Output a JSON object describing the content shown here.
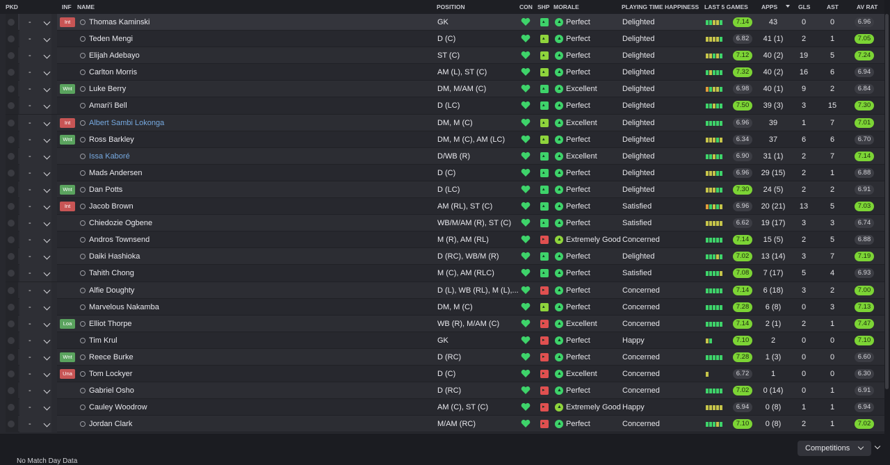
{
  "header": {
    "pkd": "PKD",
    "inf": "INF",
    "name": "NAME",
    "position": "POSITION",
    "con": "CON",
    "shp": "SHP",
    "morale": "MORALE",
    "playing_time": "PLAYING TIME HAPPINESS",
    "last5": "LAST 5 GAMES",
    "apps": "APPS",
    "gls": "GLS",
    "ast": "AST",
    "avrat": "AV RAT"
  },
  "colors": {
    "green": "#3ed36a",
    "light_green": "#8fd43c",
    "red": "#e05050",
    "rating_highlight": "#7cd435",
    "injury_tag": "#c85555",
    "want_tag": "#5aa35e"
  },
  "players": [
    {
      "inf": "Int",
      "name": "Thomas Kaminski",
      "link": false,
      "pos": "GK",
      "shp": "g",
      "morale": "Perfect",
      "mor": "g",
      "pt": "Delighted",
      "form": [
        "fg",
        "fg",
        "fy",
        "fy",
        "fg"
      ],
      "last": "7.14",
      "last_hi": true,
      "apps": "43",
      "gls": "0",
      "ast": "0",
      "av": "6.96",
      "av_hi": false
    },
    {
      "inf": "",
      "name": "Teden Mengi",
      "link": false,
      "pos": "D (C)",
      "shp": "y",
      "morale": "Perfect",
      "mor": "g",
      "pt": "Delighted",
      "form": [
        "fy",
        "fy",
        "fy",
        "fy",
        "fg"
      ],
      "last": "6.82",
      "last_hi": false,
      "apps": "41 (1)",
      "gls": "2",
      "ast": "1",
      "av": "7.05",
      "av_hi": true
    },
    {
      "inf": "",
      "name": "Elijah Adebayo",
      "link": false,
      "pos": "ST (C)",
      "shp": "y",
      "morale": "Perfect",
      "mor": "g",
      "pt": "Delighted",
      "form": [
        "fy",
        "fy",
        "fg",
        "fy",
        "fg"
      ],
      "last": "7.12",
      "last_hi": true,
      "apps": "40 (2)",
      "gls": "19",
      "ast": "5",
      "av": "7.24",
      "av_hi": true
    },
    {
      "inf": "",
      "name": "Carlton Morris",
      "link": false,
      "pos": "AM (L), ST (C)",
      "shp": "y",
      "morale": "Perfect",
      "mor": "g",
      "pt": "Delighted",
      "form": [
        "fg",
        "fy",
        "fg",
        "fg",
        "fg"
      ],
      "last": "7.32",
      "last_hi": true,
      "apps": "40 (2)",
      "gls": "16",
      "ast": "6",
      "av": "6.94",
      "av_hi": false
    },
    {
      "inf": "Wnt",
      "name": "Luke Berry",
      "link": false,
      "pos": "DM, M/AM (C)",
      "shp": "g",
      "morale": "Excellent",
      "mor": "g",
      "pt": "Delighted",
      "form": [
        "fo",
        "fg",
        "fy",
        "fy",
        "fg"
      ],
      "last": "6.98",
      "last_hi": false,
      "apps": "40 (1)",
      "gls": "9",
      "ast": "2",
      "av": "6.84",
      "av_hi": false
    },
    {
      "inf": "",
      "name": "Amari'i Bell",
      "link": false,
      "pos": "D (LC)",
      "shp": "g",
      "morale": "Perfect",
      "mor": "g",
      "pt": "Delighted",
      "form": [
        "fg",
        "fg",
        "fy",
        "fg",
        "fg"
      ],
      "last": "7.50",
      "last_hi": true,
      "apps": "39 (3)",
      "gls": "3",
      "ast": "15",
      "av": "7.30",
      "av_hi": true
    },
    {
      "inf": "Int",
      "name": "Albert Sambi Lokonga",
      "link": true,
      "pos": "DM, M (C)",
      "shp": "y",
      "morale": "Excellent",
      "mor": "g",
      "pt": "Delighted",
      "form": [
        "fg",
        "fg",
        "fg",
        "fg",
        "fg"
      ],
      "last": "6.96",
      "last_hi": false,
      "apps": "39",
      "gls": "1",
      "ast": "7",
      "av": "7.01",
      "av_hi": true
    },
    {
      "inf": "Wnt",
      "name": "Ross Barkley",
      "link": false,
      "pos": "DM, M (C), AM (LC)",
      "shp": "y",
      "morale": "Perfect",
      "mor": "g",
      "pt": "Delighted",
      "form": [
        "fy",
        "fy",
        "fy",
        "fg",
        "fy"
      ],
      "last": "6.34",
      "last_hi": false,
      "apps": "37",
      "gls": "6",
      "ast": "6",
      "av": "6.70",
      "av_hi": false
    },
    {
      "inf": "",
      "name": "Issa Kaboré",
      "link": true,
      "pos": "D/WB (R)",
      "shp": "g",
      "morale": "Excellent",
      "mor": "g",
      "pt": "Delighted",
      "form": [
        "fg",
        "fg",
        "fy",
        "fg",
        "fg"
      ],
      "last": "6.90",
      "last_hi": false,
      "apps": "31 (1)",
      "gls": "2",
      "ast": "7",
      "av": "7.14",
      "av_hi": true
    },
    {
      "inf": "",
      "name": "Mads Andersen",
      "link": false,
      "pos": "D (C)",
      "shp": "g",
      "morale": "Perfect",
      "mor": "g",
      "pt": "Delighted",
      "form": [
        "fy",
        "fy",
        "fy",
        "fg",
        "fg"
      ],
      "last": "6.96",
      "last_hi": false,
      "apps": "29 (15)",
      "gls": "2",
      "ast": "1",
      "av": "6.88",
      "av_hi": false
    },
    {
      "inf": "Wnt",
      "name": "Dan Potts",
      "link": false,
      "pos": "D (LC)",
      "shp": "g",
      "morale": "Perfect",
      "mor": "g",
      "pt": "Delighted",
      "form": [
        "fy",
        "fy",
        "fy",
        "fg",
        "fg"
      ],
      "last": "7.30",
      "last_hi": true,
      "apps": "24 (5)",
      "gls": "2",
      "ast": "2",
      "av": "6.91",
      "av_hi": false
    },
    {
      "inf": "Int",
      "name": "Jacob Brown",
      "link": false,
      "pos": "AM (RL), ST (C)",
      "shp": "g",
      "morale": "Perfect",
      "mor": "g",
      "pt": "Satisfied",
      "form": [
        "fo",
        "fg",
        "fy",
        "fg",
        "fy"
      ],
      "last": "6.96",
      "last_hi": false,
      "apps": "20 (21)",
      "gls": "13",
      "ast": "5",
      "av": "7.03",
      "av_hi": true
    },
    {
      "inf": "",
      "name": "Chiedozie Ogbene",
      "link": false,
      "pos": "WB/M/AM (R), ST (C)",
      "shp": "g",
      "morale": "Perfect",
      "mor": "g",
      "pt": "Satisfied",
      "form": [
        "fy",
        "fy",
        "fy",
        "fy",
        "fy"
      ],
      "last": "6.62",
      "last_hi": false,
      "apps": "19 (17)",
      "gls": "3",
      "ast": "3",
      "av": "6.74",
      "av_hi": false
    },
    {
      "inf": "",
      "name": "Andros Townsend",
      "link": false,
      "pos": "M (R), AM (RL)",
      "shp": "r",
      "morale": "Extremely Good",
      "mor": "lg",
      "pt": "Concerned",
      "form": [
        "fg",
        "fg",
        "fg",
        "fg",
        "fg"
      ],
      "last": "7.14",
      "last_hi": true,
      "apps": "15 (5)",
      "gls": "2",
      "ast": "5",
      "av": "6.88",
      "av_hi": false
    },
    {
      "inf": "",
      "name": "Daiki Hashioka",
      "link": false,
      "pos": "D (RC), WB/M (R)",
      "shp": "g",
      "morale": "Perfect",
      "mor": "g",
      "pt": "Delighted",
      "form": [
        "fg",
        "fg",
        "fg",
        "fy",
        "fg"
      ],
      "last": "7.02",
      "last_hi": true,
      "apps": "13 (14)",
      "gls": "3",
      "ast": "7",
      "av": "7.19",
      "av_hi": true
    },
    {
      "inf": "",
      "name": "Tahith Chong",
      "link": false,
      "pos": "M (C), AM (RLC)",
      "shp": "g",
      "morale": "Perfect",
      "mor": "g",
      "pt": "Satisfied",
      "form": [
        "fg",
        "fg",
        "fg",
        "fg",
        "fy"
      ],
      "last": "7.08",
      "last_hi": true,
      "apps": "7 (17)",
      "gls": "5",
      "ast": "4",
      "av": "6.93",
      "av_hi": false
    },
    {
      "inf": "",
      "name": "Alfie Doughty",
      "link": false,
      "pos": "D (L), WB (RL), M (L),...",
      "shp": "r",
      "morale": "Perfect",
      "mor": "g",
      "pt": "Concerned",
      "form": [
        "fg",
        "fg",
        "fg",
        "fg",
        "fg"
      ],
      "last": "7.14",
      "last_hi": true,
      "apps": "6 (18)",
      "gls": "3",
      "ast": "2",
      "av": "7.00",
      "av_hi": true
    },
    {
      "inf": "",
      "name": "Marvelous Nakamba",
      "link": false,
      "pos": "DM, M (C)",
      "shp": "y",
      "morale": "Perfect",
      "mor": "g",
      "pt": "Concerned",
      "form": [
        "fg",
        "fg",
        "fg",
        "fg",
        "fg"
      ],
      "last": "7.28",
      "last_hi": true,
      "apps": "6 (8)",
      "gls": "0",
      "ast": "3",
      "av": "7.13",
      "av_hi": true
    },
    {
      "inf": "Loa",
      "name": "Elliot Thorpe",
      "link": false,
      "pos": "WB (R), M/AM (C)",
      "shp": "r",
      "morale": "Excellent",
      "mor": "g",
      "pt": "Concerned",
      "form": [
        "fg",
        "fg",
        "fg",
        "fg",
        "fg"
      ],
      "last": "7.14",
      "last_hi": true,
      "apps": "2 (1)",
      "gls": "2",
      "ast": "1",
      "av": "7.47",
      "av_hi": true
    },
    {
      "inf": "",
      "name": "Tim Krul",
      "link": false,
      "pos": "GK",
      "shp": "r",
      "morale": "Perfect",
      "mor": "g",
      "pt": "Happy",
      "form": [
        "fy",
        "fg"
      ],
      "last": "7.10",
      "last_hi": true,
      "apps": "2",
      "gls": "0",
      "ast": "0",
      "av": "7.10",
      "av_hi": true
    },
    {
      "inf": "Wnt",
      "name": "Reece Burke",
      "link": false,
      "pos": "D (RC)",
      "shp": "r",
      "morale": "Perfect",
      "mor": "g",
      "pt": "Concerned",
      "form": [
        "fg",
        "fg",
        "fg",
        "fg",
        "fg"
      ],
      "last": "7.28",
      "last_hi": true,
      "apps": "1 (3)",
      "gls": "0",
      "ast": "0",
      "av": "6.60",
      "av_hi": false
    },
    {
      "inf": "Una",
      "name": "Tom Lockyer",
      "link": false,
      "pos": "D (C)",
      "shp": "r",
      "morale": "Excellent",
      "mor": "g",
      "pt": "Concerned",
      "form": [
        "fy"
      ],
      "last": "6.72",
      "last_hi": false,
      "apps": "1",
      "gls": "0",
      "ast": "0",
      "av": "6.30",
      "av_hi": false
    },
    {
      "inf": "",
      "name": "Gabriel Osho",
      "link": false,
      "pos": "D (RC)",
      "shp": "r",
      "morale": "Perfect",
      "mor": "g",
      "pt": "Concerned",
      "form": [
        "fg",
        "fg",
        "fg",
        "fg",
        "fg"
      ],
      "last": "7.02",
      "last_hi": true,
      "apps": "0 (14)",
      "gls": "0",
      "ast": "1",
      "av": "6.91",
      "av_hi": false
    },
    {
      "inf": "",
      "name": "Cauley Woodrow",
      "link": false,
      "pos": "AM (C), ST (C)",
      "shp": "r",
      "morale": "Extremely Good",
      "mor": "lg",
      "pt": "Happy",
      "form": [
        "fy",
        "fy",
        "fy",
        "fy",
        "fy"
      ],
      "last": "6.94",
      "last_hi": false,
      "apps": "0 (8)",
      "gls": "1",
      "ast": "1",
      "av": "6.94",
      "av_hi": false
    },
    {
      "inf": "",
      "name": "Jordan Clark",
      "link": false,
      "pos": "M/AM (RC)",
      "shp": "r",
      "morale": "Perfect",
      "mor": "g",
      "pt": "Concerned",
      "form": [
        "fg",
        "fg",
        "fg",
        "fy",
        "fg"
      ],
      "last": "7.10",
      "last_hi": true,
      "apps": "0 (8)",
      "gls": "2",
      "ast": "1",
      "av": "7.02",
      "av_hi": true
    }
  ],
  "row_dash": "-",
  "footer": {
    "competitions_label": "Competitions",
    "bottom_note": "No Match Day Data"
  },
  "icons": {
    "condition": "heart-icon",
    "sharpness": "sharpness-icon",
    "morale": "morale-icon",
    "person": "person-icon",
    "chevron": "chevron-down-icon"
  }
}
